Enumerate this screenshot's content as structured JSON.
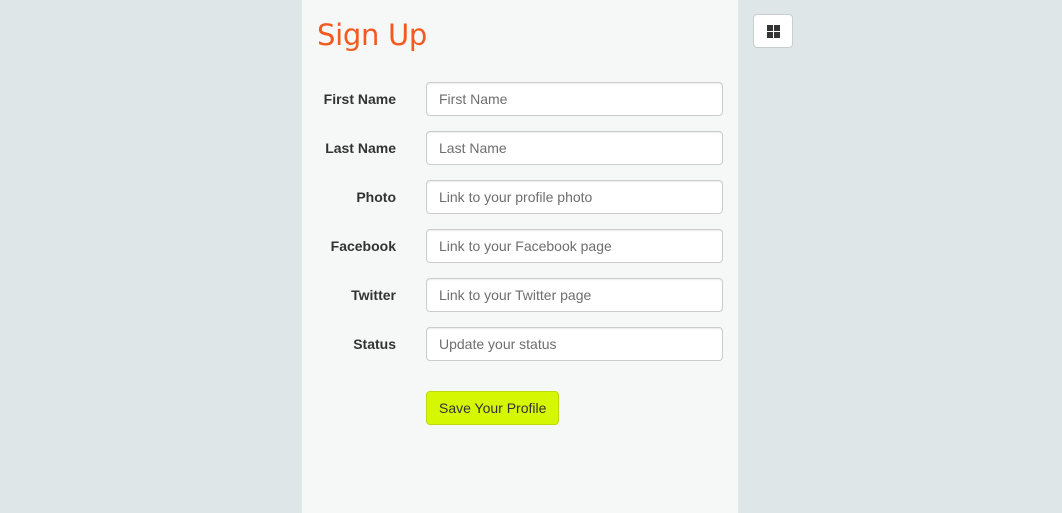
{
  "form": {
    "title": "Sign Up",
    "fields": [
      {
        "label": "First Name",
        "placeholder": "First Name",
        "value": ""
      },
      {
        "label": "Last Name",
        "placeholder": "Last Name",
        "value": ""
      },
      {
        "label": "Photo",
        "placeholder": "Link to your profile photo",
        "value": ""
      },
      {
        "label": "Facebook",
        "placeholder": "Link to your Facebook page",
        "value": ""
      },
      {
        "label": "Twitter",
        "placeholder": "Link to your Twitter page",
        "value": ""
      },
      {
        "label": "Status",
        "placeholder": "Update your status",
        "value": ""
      }
    ],
    "submit_label": "Save Your Profile"
  },
  "toolbar": {
    "grid_icon": "grid-icon"
  },
  "colors": {
    "page_background": "#dfe6e8",
    "panel_background": "#f6f8f7",
    "title": "#f25a1f",
    "submit_button": "#d6f702"
  }
}
